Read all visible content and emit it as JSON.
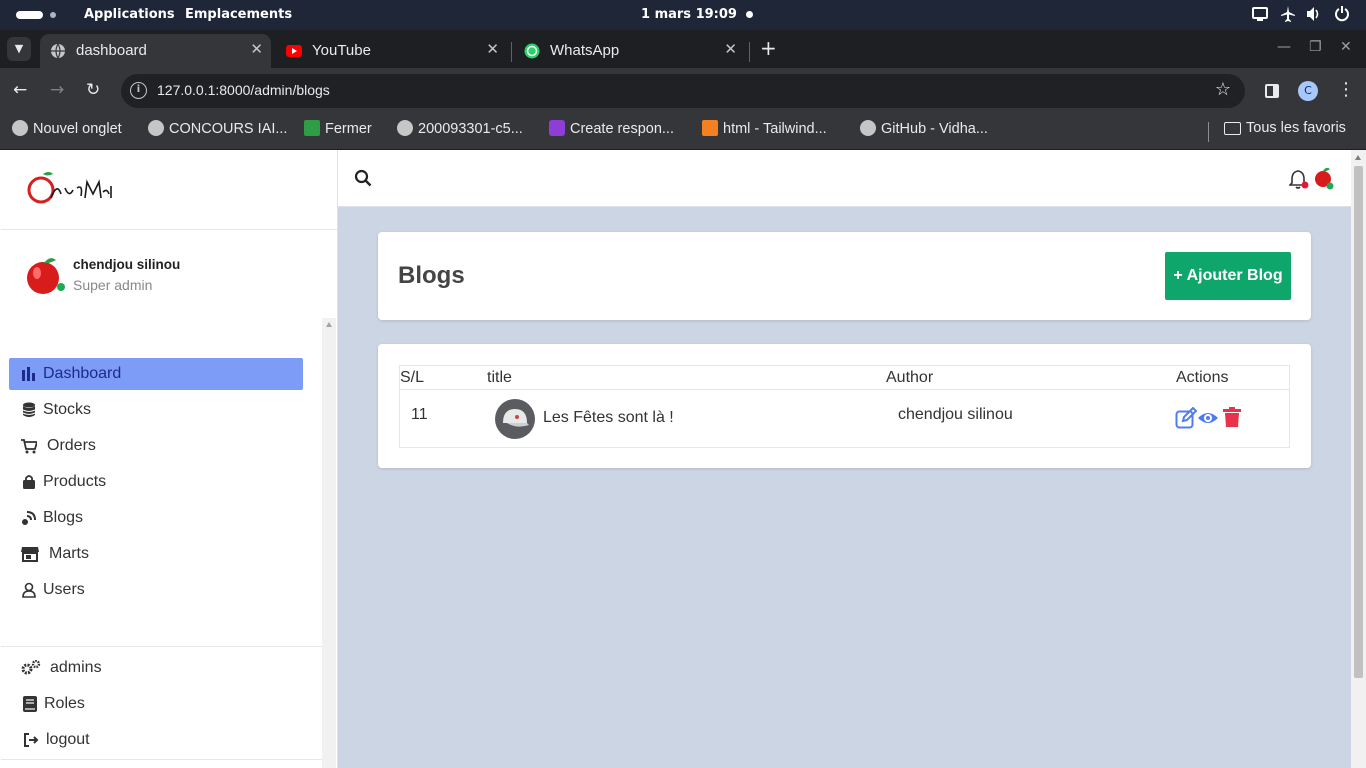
{
  "os": {
    "applications": "Applications",
    "places": "Emplacements",
    "clock": "1 mars  19:09"
  },
  "browser": {
    "tabs": [
      {
        "label": "dashboard",
        "active": true
      },
      {
        "label": "YouTube",
        "active": false
      },
      {
        "label": "WhatsApp",
        "active": false
      }
    ],
    "url": "127.0.0.1:8000/admin/blogs",
    "profile_initial": "C",
    "bookmarks": [
      "Nouvel onglet",
      "CONCOURS IAI...",
      "Fermer",
      "200093301-c5...",
      "Create respon...",
      "html - Tailwind...",
      "GitHub - Vidha..."
    ],
    "all_bookmarks": "Tous les favoris"
  },
  "sidebar": {
    "user_name": "chendjou silinou",
    "user_role": "Super admin",
    "nav": [
      {
        "label": "Dashboard",
        "icon": "chart-bar-icon",
        "active": true
      },
      {
        "label": "Stocks",
        "icon": "database-icon"
      },
      {
        "label": "Orders",
        "icon": "cart-icon"
      },
      {
        "label": "Products",
        "icon": "bag-icon"
      },
      {
        "label": "Blogs",
        "icon": "blog-icon"
      },
      {
        "label": "Marts",
        "icon": "store-icon"
      },
      {
        "label": "Users",
        "icon": "user-icon"
      }
    ],
    "bottom": [
      {
        "label": "admins",
        "icon": "gears-icon"
      },
      {
        "label": "Roles",
        "icon": "book-icon"
      },
      {
        "label": "logout",
        "icon": "logout-icon"
      }
    ]
  },
  "main": {
    "title": "Blogs",
    "add_button": "+ Ajouter Blog",
    "table": {
      "headers": [
        "S/L",
        "title",
        "Author",
        "Actions"
      ],
      "rows": [
        {
          "sl": "11",
          "title": "Les Fêtes sont là !",
          "author": "chendjou silinou"
        }
      ]
    }
  },
  "colors": {
    "accent_active": "#7d9cf7",
    "add_button": "#0ea66b",
    "page_bg": "#ccd5e4",
    "edit": "#4f7cf2",
    "delete": "#e8314a"
  }
}
